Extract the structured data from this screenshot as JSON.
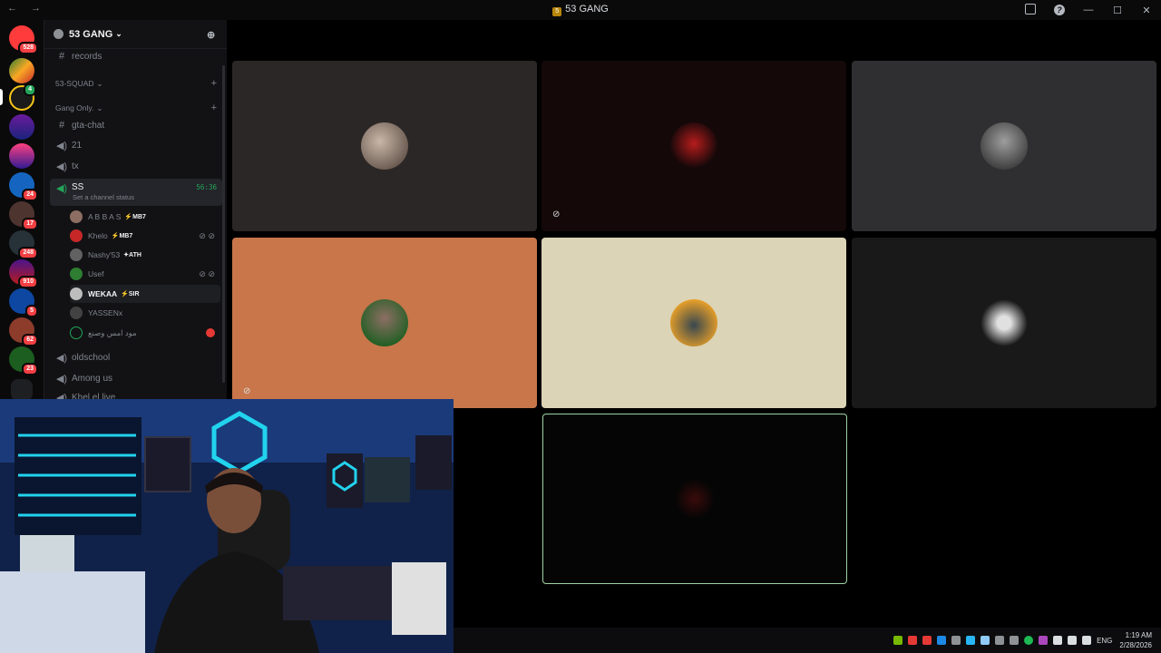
{
  "window": {
    "title": "53 GANG",
    "nav": "← →",
    "server_glyph": "5",
    "minimize": "—",
    "maximize": "☐",
    "close": "✕",
    "help": "?"
  },
  "servers": {
    "badges": [
      "528",
      "4",
      "24",
      "17",
      "248",
      "910",
      "5",
      "62",
      "23"
    ]
  },
  "sidebar": {
    "guild_name": "53 GANG",
    "chevron": "⌄",
    "channels": {
      "records": "records",
      "category_squad": "53-SQUAD",
      "category_gang": "Gang Only.",
      "gta_chat": "gta-chat",
      "ch_21": "21",
      "ch_tx": "tx",
      "ch_ss": "SS",
      "ss_timer": "56:36",
      "ss_status": "Set a channel status",
      "oldschool": "oldschool",
      "among_us": "Among us",
      "khel": "Khel el live"
    },
    "users": [
      {
        "name": "A B B A S",
        "tag": "MB7"
      },
      {
        "name": "Khelo",
        "tag": "MB7"
      },
      {
        "name": "Nashy'53",
        "tag": "ATH"
      },
      {
        "name": "Usef"
      },
      {
        "name": "WEKAA",
        "tag": "SIR"
      },
      {
        "name": "YASSENx"
      },
      {
        "name": "مود امس وصنع"
      }
    ]
  },
  "taskbar": {
    "lang": "ENG",
    "time": "1:19 AM",
    "date": "2/28/2026"
  },
  "colors": {
    "accent": "#5865f2",
    "speaking_green": "#23a55a",
    "badge_red": "#f23f43",
    "tile_orange": "#c8764a",
    "tile_cream": "#dcd4b6"
  }
}
